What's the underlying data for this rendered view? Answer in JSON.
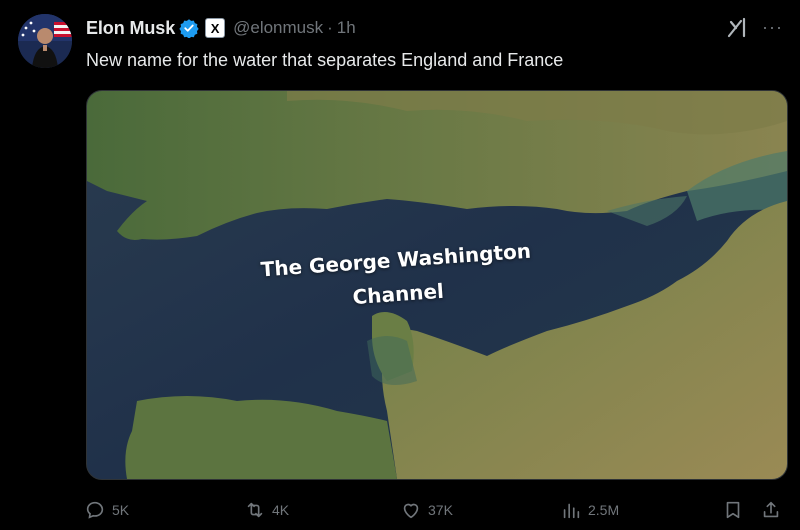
{
  "author": {
    "display_name": "Elon Musk",
    "handle": "@elonmusk",
    "separator": "·",
    "time": "1h",
    "affiliate_badge": "X"
  },
  "post": {
    "text": "New name for the water that separates England and France",
    "image_label_line1": "The George Washington",
    "image_label_line2": "Channel"
  },
  "header_icons": {
    "grok": "grok-icon",
    "more": "···"
  },
  "actions": {
    "replies": "5K",
    "reposts": "4K",
    "likes": "37K",
    "views": "2.5M"
  },
  "colors": {
    "background": "#000000",
    "text": "#e7e9ea",
    "muted": "#71767b",
    "verified": "#1d9bf0"
  }
}
